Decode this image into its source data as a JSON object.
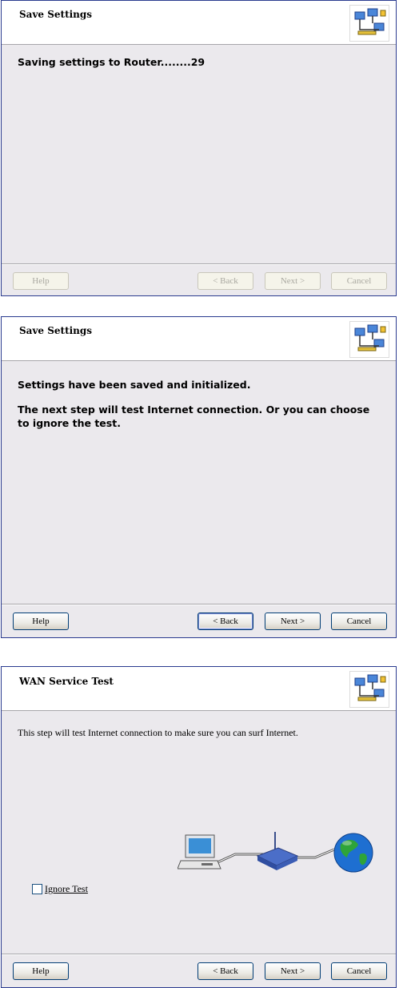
{
  "dialogs": [
    {
      "title": "Save Settings",
      "body": [
        "Saving settings to Router........29"
      ],
      "buttons": {
        "help": "Help",
        "back": "< Back",
        "next": "Next >",
        "cancel": "Cancel"
      }
    },
    {
      "title": "Save Settings",
      "body": [
        "Settings have been saved and initialized.",
        "The next step will test Internet connection. Or you can choose to ignore the test."
      ],
      "buttons": {
        "help": "Help",
        "back": "< Back",
        "next": "Next >",
        "cancel": "Cancel"
      }
    },
    {
      "title": "WAN Service Test",
      "body": [
        "This step will test Internet connection to make sure you can surf Internet."
      ],
      "checkbox": {
        "label": "Ignore Test",
        "checked": false
      },
      "buttons": {
        "help": "Help",
        "back": "< Back",
        "next": "Next >",
        "cancel": "Cancel"
      }
    }
  ],
  "icons": {
    "header_logo": "network-wizard-icon",
    "diagram": [
      "computer-icon",
      "router-icon",
      "globe-icon"
    ]
  },
  "colors": {
    "dialog_border": "#2a3b8f",
    "dialog_bg": "#ebe9ed",
    "button_border": "#003c74",
    "globe_blue": "#1e6fd1",
    "globe_green": "#2ea43a"
  }
}
